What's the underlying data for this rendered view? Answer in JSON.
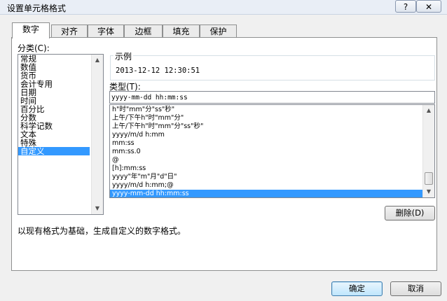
{
  "window": {
    "title": "设置单元格格式",
    "help_label": "?",
    "close_label": "✕"
  },
  "tabs": [
    {
      "label": "数字",
      "active": true
    },
    {
      "label": "对齐"
    },
    {
      "label": "字体"
    },
    {
      "label": "边框"
    },
    {
      "label": "填充"
    },
    {
      "label": "保护"
    }
  ],
  "category": {
    "label": "分类(C):",
    "items": [
      "常规",
      "数值",
      "货币",
      "会计专用",
      "日期",
      "时间",
      "百分比",
      "分数",
      "科学记数",
      "文本",
      "特殊",
      "自定义"
    ],
    "selected": "自定义"
  },
  "sample": {
    "label": "示例",
    "value": "2013-12-12 12:30:51"
  },
  "type_field": {
    "label": "类型(T):",
    "value": "yyyy-mm-dd hh:mm:ss",
    "items": [
      "h\"时\"mm\"分\"ss\"秒\"",
      "上午/下午h\"时\"mm\"分\"",
      "上午/下午h\"时\"mm\"分\"ss\"秒\"",
      "yyyy/m/d h:mm",
      "mm:ss",
      "mm:ss.0",
      "@",
      "[h]:mm:ss",
      "yyyy\"年\"m\"月\"d\"日\"",
      "yyyy/m/d h:mm;@",
      "yyyy-mm-dd hh:mm:ss"
    ],
    "selected": "yyyy-mm-dd hh:mm:ss"
  },
  "delete_button": "删除(D)",
  "description": "以现有格式为基础，生成自定义的数字格式。",
  "footer": {
    "ok_label": "确定",
    "cancel_label": "取消"
  }
}
